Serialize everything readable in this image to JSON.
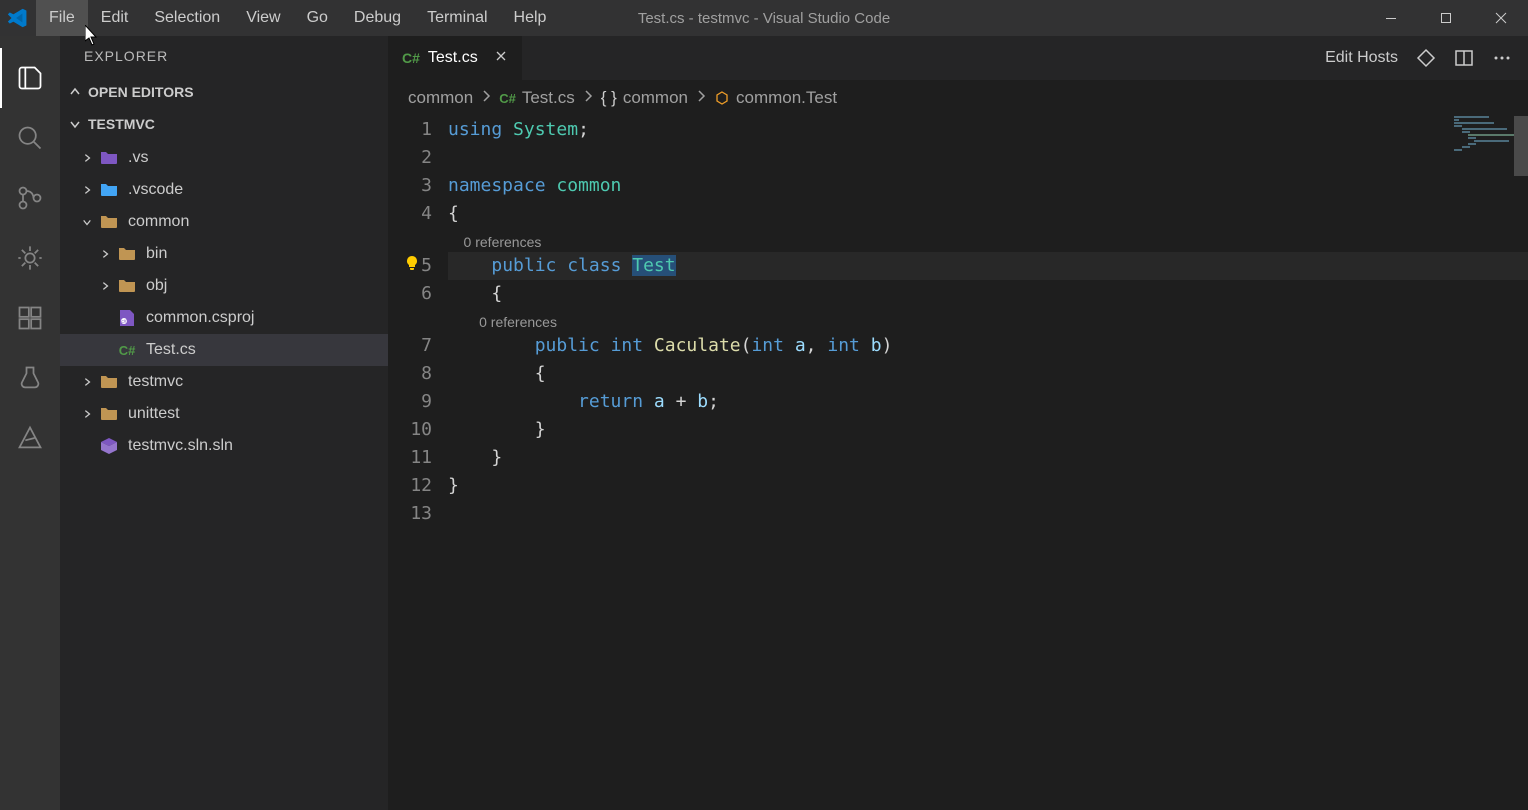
{
  "titlebar": {
    "title": "Test.cs - testmvc - Visual Studio Code"
  },
  "menu": [
    {
      "label": "File"
    },
    {
      "label": "Edit"
    },
    {
      "label": "Selection"
    },
    {
      "label": "View"
    },
    {
      "label": "Go"
    },
    {
      "label": "Debug"
    },
    {
      "label": "Terminal"
    },
    {
      "label": "Help"
    }
  ],
  "sidebar": {
    "title": "EXPLORER",
    "sections": {
      "openEditors": "OPEN EDITORS",
      "project": "TESTMVC"
    },
    "tree": [
      {
        "name": ".vs",
        "type": "folder",
        "icon": "special",
        "indent": 0,
        "expanded": false
      },
      {
        "name": ".vscode",
        "type": "folder",
        "icon": "blue",
        "indent": 0,
        "expanded": false
      },
      {
        "name": "common",
        "type": "folder",
        "icon": "folder",
        "indent": 0,
        "expanded": true
      },
      {
        "name": "bin",
        "type": "folder",
        "icon": "folder",
        "indent": 1,
        "expanded": false
      },
      {
        "name": "obj",
        "type": "folder",
        "icon": "folder",
        "indent": 1,
        "expanded": false
      },
      {
        "name": "common.csproj",
        "type": "file",
        "icon": "csproj",
        "indent": 1
      },
      {
        "name": "Test.cs",
        "type": "file",
        "icon": "cs",
        "indent": 1,
        "selected": true
      },
      {
        "name": "testmvc",
        "type": "folder",
        "icon": "folder",
        "indent": 0,
        "expanded": false
      },
      {
        "name": "unittest",
        "type": "folder",
        "icon": "folder",
        "indent": 0,
        "expanded": false
      },
      {
        "name": "testmvc.sln.sln",
        "type": "file",
        "icon": "sln",
        "indent": 0
      }
    ]
  },
  "tabs": [
    {
      "label": "Test.cs",
      "icon": "cs",
      "active": true
    }
  ],
  "tabActions": {
    "editHosts": "Edit Hosts"
  },
  "breadcrumbs": [
    {
      "label": "common",
      "icon": null
    },
    {
      "label": "Test.cs",
      "icon": "cs"
    },
    {
      "label": "common",
      "icon": "namespace"
    },
    {
      "label": "common.Test",
      "icon": "class"
    }
  ],
  "code": {
    "codelens1": "0 references",
    "codelens2": "0 references",
    "lines": [
      {
        "n": 1,
        "tokens": [
          [
            "using ",
            "keyword"
          ],
          [
            "System",
            "namespace"
          ],
          [
            ";",
            "punct"
          ]
        ]
      },
      {
        "n": 2,
        "tokens": []
      },
      {
        "n": 3,
        "tokens": [
          [
            "namespace ",
            "keyword"
          ],
          [
            "common",
            "namespace"
          ]
        ]
      },
      {
        "n": 4,
        "tokens": [
          [
            "{",
            "punct"
          ]
        ]
      },
      {
        "n": 5,
        "tokens": [
          [
            "    ",
            ""
          ],
          [
            "public ",
            "keyword"
          ],
          [
            "class ",
            "keyword"
          ],
          [
            "Test",
            "type-sel"
          ]
        ],
        "highlighted": true,
        "lightbulb": true
      },
      {
        "n": 6,
        "tokens": [
          [
            "    {",
            "punct"
          ]
        ]
      },
      {
        "n": 7,
        "tokens": [
          [
            "        ",
            ""
          ],
          [
            "public ",
            "keyword"
          ],
          [
            "int ",
            "keyword"
          ],
          [
            "Caculate",
            "method"
          ],
          [
            "(",
            "punct"
          ],
          [
            "int ",
            "keyword"
          ],
          [
            "a",
            "param"
          ],
          [
            ", ",
            "punct"
          ],
          [
            "int ",
            "keyword"
          ],
          [
            "b",
            "param"
          ],
          [
            ")",
            "punct"
          ]
        ]
      },
      {
        "n": 8,
        "tokens": [
          [
            "        {",
            "punct"
          ]
        ]
      },
      {
        "n": 9,
        "tokens": [
          [
            "            ",
            ""
          ],
          [
            "return ",
            "keyword"
          ],
          [
            "a",
            "param"
          ],
          [
            " + ",
            "punct"
          ],
          [
            "b",
            "param"
          ],
          [
            ";",
            "punct"
          ]
        ]
      },
      {
        "n": 10,
        "tokens": [
          [
            "        }",
            "punct"
          ]
        ]
      },
      {
        "n": 11,
        "tokens": [
          [
            "    }",
            "punct"
          ]
        ]
      },
      {
        "n": 12,
        "tokens": [
          [
            "}",
            "punct"
          ]
        ]
      },
      {
        "n": 13,
        "tokens": []
      }
    ]
  }
}
